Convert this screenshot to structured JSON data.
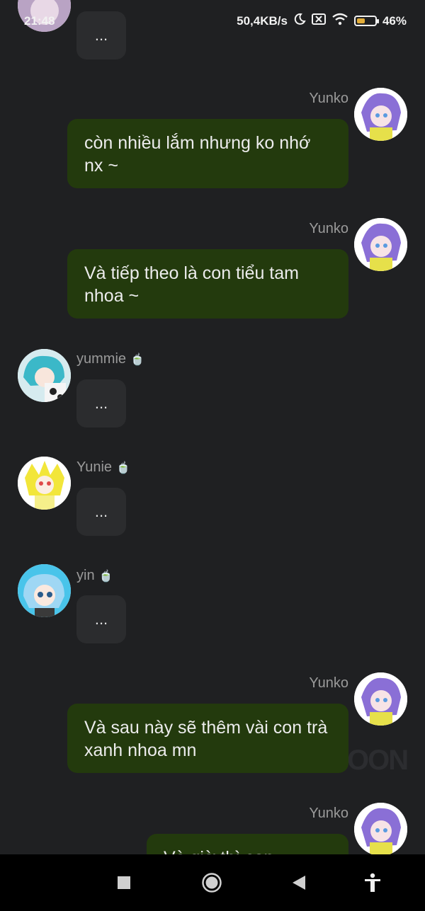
{
  "status": {
    "time": "21:48",
    "net_speed": "50,4KB/s",
    "battery_percent": "46%",
    "battery_level": 0.46
  },
  "messages": [
    {
      "kind": "in",
      "text": "..."
    },
    {
      "kind": "out",
      "sender": "Yunko",
      "text": "còn nhiều lắm nhưng ko nhớ nx ~"
    },
    {
      "kind": "out",
      "sender": "Yunko",
      "text": "Và tiếp theo là con tiểu tam nhoa ~"
    },
    {
      "kind": "in",
      "sender": "yummie",
      "badge": "🍵",
      "text": "..."
    },
    {
      "kind": "in",
      "sender": "Yunie",
      "badge": "🍵",
      "text": "..."
    },
    {
      "kind": "in",
      "sender": "yin",
      "badge": "🍵",
      "text": "..."
    },
    {
      "kind": "out",
      "sender": "Yunko",
      "text": "Và sau này sẽ thêm vài con trà xanh nhoa mn"
    },
    {
      "kind": "out",
      "sender": "Yunko",
      "text": "Và giờ thì con..."
    }
  ],
  "watermark": "OON",
  "nav": {
    "recent_icon": "square-icon",
    "home_icon": "circle-icon",
    "back_icon": "triangle-back-icon",
    "accessibility_icon": "accessibility-icon"
  },
  "colors": {
    "background": "#1f2022",
    "outgoing_bubble": "#233a0d",
    "incoming_bubble": "#2b2c2e",
    "battery": "#e2ad3a"
  }
}
